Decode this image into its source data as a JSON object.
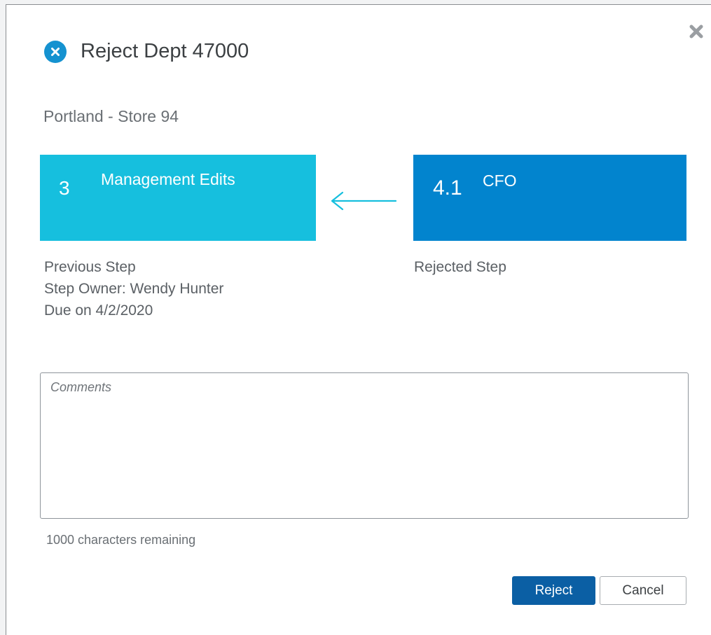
{
  "dialog": {
    "title": "Reject Dept 47000",
    "subtitle": "Portland - Store 94",
    "title_icon": "x-circle-icon",
    "close_icon": "close-icon"
  },
  "previous_step": {
    "number": "3",
    "name": "Management Edits",
    "label": "Previous Step",
    "owner": "Step Owner: Wendy Hunter",
    "due": "Due on 4/2/2020",
    "color": "#16bfde"
  },
  "rejected_step": {
    "number": "4.1",
    "name": "CFO",
    "label": "Rejected Step",
    "color": "#0284ce"
  },
  "arrow_icon": "arrow-left-icon",
  "comments": {
    "placeholder": "Comments",
    "value": "",
    "remaining": "1000 characters remaining"
  },
  "buttons": {
    "reject_label": "Reject",
    "cancel_label": "Cancel",
    "reject_color": "#0b5fa4"
  }
}
